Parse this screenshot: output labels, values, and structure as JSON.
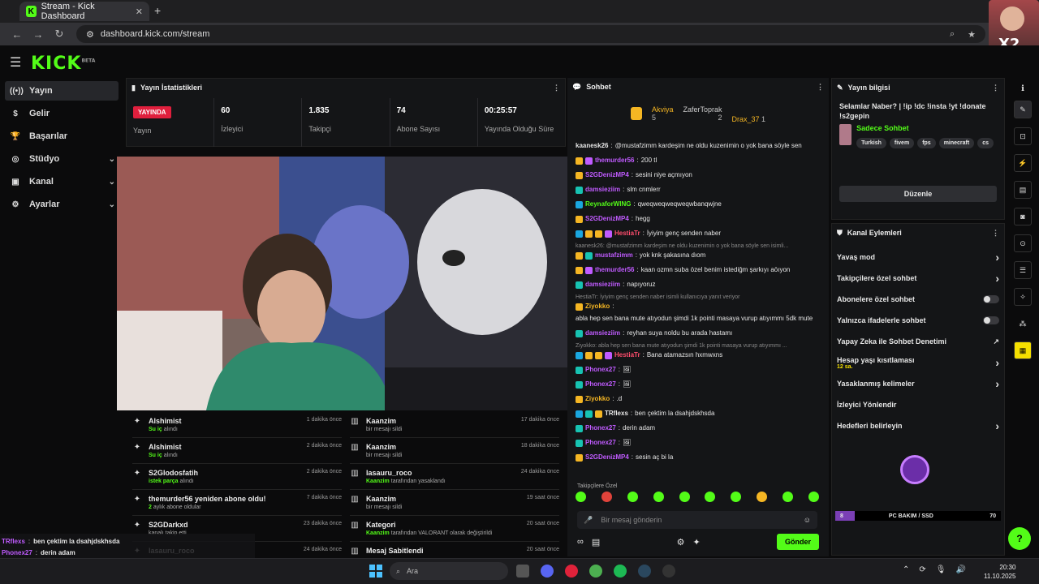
{
  "browser": {
    "tab_title": "Stream - Kick Dashboard",
    "url": "dashboard.kick.com/stream"
  },
  "brand": {
    "logo": "KICK",
    "beta": "BETA",
    "accent": "#53fc18"
  },
  "sidebar": {
    "items": [
      {
        "label": "Yayın",
        "icon": "broadcast-icon"
      },
      {
        "label": "Gelir",
        "icon": "dollar-icon"
      },
      {
        "label": "Başarılar",
        "icon": "trophy-icon"
      },
      {
        "label": "Stüdyo",
        "icon": "studio-icon"
      },
      {
        "label": "Kanal",
        "icon": "channel-icon"
      },
      {
        "label": "Ayarlar",
        "icon": "gear-icon"
      }
    ]
  },
  "stats": {
    "title": "Yayın İstatistikleri",
    "live_badge": "YAYINDA",
    "live_label": "Yayın",
    "items": [
      {
        "value": "60",
        "label": "İzleyici"
      },
      {
        "value": "1.835",
        "label": "Takipçi"
      },
      {
        "value": "74",
        "label": "Abone Sayısı"
      },
      {
        "value": "00:25:57",
        "label": "Yayında Olduğu Süre"
      }
    ]
  },
  "activity": {
    "left": [
      {
        "name": "Alshimist",
        "sub_hi": "Su iç",
        "sub": "alındı",
        "time": "1 dakika önce"
      },
      {
        "name": "Alshimist",
        "sub_hi": "Su iç",
        "sub": "alındı",
        "time": "2 dakika önce"
      },
      {
        "name": "S2Glodosfatih",
        "sub_hi": "istek parça",
        "sub": "alındı",
        "time": "2 dakika önce"
      },
      {
        "name": "themurder56 yeniden abone oldu!",
        "sub_hi": "2",
        "sub": "aylık abone oldular",
        "time": "7 dakika önce"
      },
      {
        "name": "S2GDarkxd",
        "sub_hi": "",
        "sub": "kanalı takip etti",
        "time": "23 dakika önce"
      },
      {
        "name": "lasauru_roco",
        "sub_hi": "",
        "sub": "",
        "time": "24 dakika önce"
      }
    ],
    "right": [
      {
        "name": "Kaanzim",
        "sub_hi": "",
        "sub": "bir mesajı sildi",
        "time": "17 dakika önce"
      },
      {
        "name": "Kaanzim",
        "sub_hi": "",
        "sub": "bir mesajı sildi",
        "time": "18 dakika önce"
      },
      {
        "name": "lasauru_roco",
        "sub_hi": "Kaanzim",
        "sub": "tarafından yasaklandı",
        "time": "24 dakika önce"
      },
      {
        "name": "Kaanzim",
        "sub_hi": "",
        "sub": "bir mesajı sildi",
        "time": "19 saat önce"
      },
      {
        "name": "Kategori",
        "sub_hi": "Kaanzim",
        "sub": "tarafından VALORANT olarak değiştirildi",
        "time": "20 saat önce"
      },
      {
        "name": "Mesaj Sabitlendi",
        "sub_hi": "",
        "sub": "",
        "time": "20 saat önce"
      }
    ]
  },
  "chat": {
    "title": "Sohbet",
    "leaders": [
      {
        "name": "Akviya",
        "count": "5"
      },
      {
        "name": "ZaferToprak",
        "count": "2"
      },
      {
        "name": "Drax_37",
        "count": "1"
      }
    ],
    "messages": [
      {
        "reply": "",
        "user": "kaanesk26",
        "color": "#e6e6e6",
        "badges": [],
        "text": "@mustafzimm kardeşim ne oldu kuzenimin o yok bana söyle sen"
      },
      {
        "reply": "",
        "user": "themurder56",
        "color": "#c05bff",
        "badges": [
          "g",
          "p"
        ],
        "text": "200 tl"
      },
      {
        "reply": "",
        "user": "S2GDenizMP4",
        "color": "#c05bff",
        "badges": [
          "g"
        ],
        "text": "sesini niye açmıyon"
      },
      {
        "reply": "",
        "user": "damsieziim",
        "color": "#c05bff",
        "badges": [
          "t"
        ],
        "text": "slm cnmlerr"
      },
      {
        "reply": "",
        "user": "ReynaforWING",
        "color": "#53fc18",
        "badges": [
          "b"
        ],
        "text": "qweqweqweqweqwbanqwjne"
      },
      {
        "reply": "",
        "user": "S2GDenizMP4",
        "color": "#c05bff",
        "badges": [
          "g"
        ],
        "text": "hegg"
      },
      {
        "reply": "",
        "user": "HestiaTr",
        "color": "#ff4d6d",
        "badges": [
          "b",
          "g",
          "g",
          "p"
        ],
        "text": "İyiyim genç senden naber"
      },
      {
        "reply": "kaanesk26: @mustafzimm kardeşim ne oldu kuzenimin o yok bana söyle sen isimli...",
        "user": "mustafzimm",
        "color": "#c05bff",
        "badges": [
          "g",
          "t"
        ],
        "text": "yok knk şakasına dıom"
      },
      {
        "reply": "",
        "user": "themurder56",
        "color": "#c05bff",
        "badges": [
          "g",
          "p"
        ],
        "text": "kaan ozmn suba özel benim istediğm şarkıyı aöıyon"
      },
      {
        "reply": "",
        "user": "damsieziim",
        "color": "#c05bff",
        "badges": [
          "t"
        ],
        "text": "napıyoruz"
      },
      {
        "reply": "HestiaTr: İyiyim genç senden naber isimli kullanıcıya yanıt veriyor",
        "user": "Ziyokko",
        "color": "#f5b623",
        "badges": [
          "g"
        ],
        "text": "abla hep sen bana mute atıyodun şimdi 1k pointi masaya vurup atıyımmı 5dk mute"
      },
      {
        "reply": "",
        "user": "damsieziim",
        "color": "#c05bff",
        "badges": [
          "t"
        ],
        "text": "reyhan suya noldu bu arada hastamı"
      },
      {
        "reply": "Ziyokko: abla hep sen bana mute atıyodun şimdi 1k pointi masaya vurup atıyımmı ...",
        "user": "HestiaTr",
        "color": "#ff4d6d",
        "badges": [
          "b",
          "g",
          "g",
          "p"
        ],
        "text": "Bana atamazsın hxmwxns"
      },
      {
        "reply": "",
        "user": "Phonex27",
        "color": "#c05bff",
        "badges": [
          "t"
        ],
        "text": "🖼"
      },
      {
        "reply": "",
        "user": "Phonex27",
        "color": "#c05bff",
        "badges": [
          "t"
        ],
        "text": "🖼"
      },
      {
        "reply": "",
        "user": "Ziyokko",
        "color": "#f5b623",
        "badges": [
          "g"
        ],
        "text": ".d"
      },
      {
        "reply": "",
        "user": "TRflexs",
        "color": "#e6e6e6",
        "badges": [
          "b",
          "t",
          "g"
        ],
        "text": "ben çektim la dsahjdskhsda"
      },
      {
        "reply": "",
        "user": "Phonex27",
        "color": "#c05bff",
        "badges": [
          "t"
        ],
        "text": "derin adam"
      },
      {
        "reply": "",
        "user": "Phonex27",
        "color": "#c05bff",
        "badges": [
          "t"
        ],
        "text": "🖼"
      },
      {
        "reply": "",
        "user": "S2GDenizMP4",
        "color": "#c05bff",
        "badges": [
          "g"
        ],
        "text": "sesin aç bi la"
      }
    ],
    "followers_only": "Takipçilere Özel",
    "input_placeholder": "Bir mesaj gönderin",
    "send_label": "Gönder"
  },
  "info": {
    "title": "Yayın bilgisi",
    "stream_title": "Selamlar Naber? | !ip !dc !insta !yt !donate !s2gepin",
    "category": "Sadece Sohbet",
    "tags": [
      "Turkish",
      "fivem",
      "fps",
      "minecraft",
      "cs"
    ],
    "edit_label": "Düzenle"
  },
  "actions": {
    "title": "Kanal Eylemleri",
    "items": [
      {
        "label": "Yavaş mod",
        "kind": "chevron"
      },
      {
        "label": "Takipçilere özel sohbet",
        "kind": "chevron"
      },
      {
        "label": "Abonelere özel sohbet",
        "kind": "toggle"
      },
      {
        "label": "Yalnızca ifadelerle sohbet",
        "kind": "toggle"
      },
      {
        "label": "Yapay Zeka ile Sohbet Denetimi",
        "kind": "external"
      },
      {
        "label": "Hesap yaşı kısıtlaması",
        "kind": "chevron",
        "sub": "12 sa."
      },
      {
        "label": "Yasaklanmış kelimeler",
        "kind": "chevron"
      },
      {
        "label": "İzleyici Yönlendir",
        "kind": "none"
      },
      {
        "label": "Hedefleri belirleyin",
        "kind": "chevron"
      }
    ],
    "goal_label": "PC BAKIM / SSD",
    "goal_start": "8",
    "goal_value": "70"
  },
  "overlay": {
    "lines": [
      {
        "user": "TRflexs",
        "text": "ben çektim la dsahjdskhsda"
      },
      {
        "user": "Phonex27",
        "text": "derin adam"
      },
      {
        "user": "Phonex27",
        "text": ""
      },
      {
        "user": "S2GDenizMP4",
        "text": "sesin aç bi la"
      }
    ]
  },
  "taskbar": {
    "search": "Ara",
    "time": "20:30",
    "date": "11.10.2025"
  },
  "webcam_badge": "X2"
}
